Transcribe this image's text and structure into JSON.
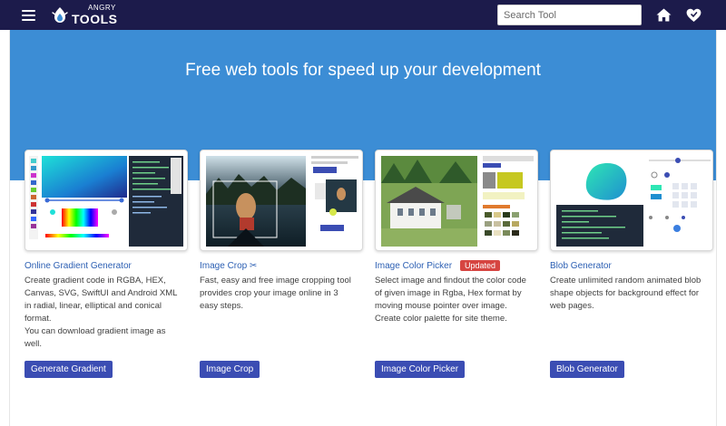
{
  "header": {
    "logo_small": "ANGRY",
    "logo_large": "TOOLS",
    "search_placeholder": "Search Tool",
    "menu_icon": "hamburger-menu-icon",
    "home_icon": "home-icon",
    "favorites_icon": "heart-icon"
  },
  "hero": {
    "title": "Free web tools for speed up your development",
    "background_color": "#3c8dd5"
  },
  "colors": {
    "navbar": "#1c1b4b",
    "button": "#3b4db3",
    "link": "#2c5fb3",
    "badge": "#d64541"
  },
  "cards": [
    {
      "title": "Online Gradient Generator",
      "badge": "",
      "description": "Create gradient code in RGBA, HEX, Canvas, SVG, SwiftUI and Android XML in radial, linear, elliptical and conical format.\nYou can download gradient image as well.",
      "button": "Generate Gradient"
    },
    {
      "title": "Image Crop ✂",
      "badge": "",
      "description": "Fast, easy and free image cropping tool provides crop your image online in 3 easy steps.",
      "button": "Image Crop"
    },
    {
      "title": "Image Color Picker",
      "badge": "Updated",
      "description": "Select image and findout the color code of given image in Rgba, Hex format by moving mouse pointer over image. Create color palette for site theme.",
      "button": "Image Color Picker"
    },
    {
      "title": "Blob Generator",
      "badge": "",
      "description": "Create unlimited random animated blob shape objects for background effect for web pages.",
      "button": "Blob Generator"
    }
  ]
}
